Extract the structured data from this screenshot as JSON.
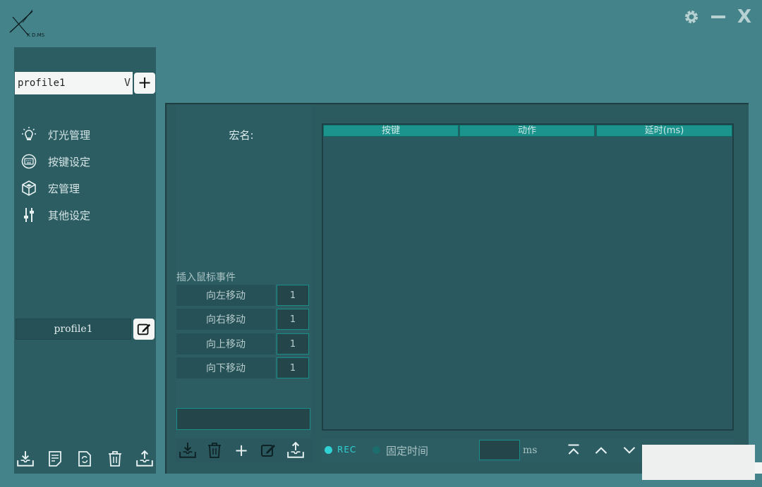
{
  "window": {
    "logo_text": "X D.MS",
    "controls": {
      "settings_icon": "gear-icon",
      "minimize_icon": "minimize-icon",
      "close_label": "X"
    }
  },
  "sidebar": {
    "profile_select": {
      "value": "profile1",
      "chevron": "V"
    },
    "add_profile_label": "+",
    "items": [
      {
        "label": "灯光管理",
        "icon": "lightbulb-icon"
      },
      {
        "label": "按键设定",
        "icon": "keyboard-icon"
      },
      {
        "label": "宏管理",
        "icon": "cube-icon"
      },
      {
        "label": "其他设定",
        "icon": "sliders-icon"
      }
    ],
    "profile_name": "profile1",
    "footer_icons": [
      "import-icon",
      "notes-icon",
      "refresh-file-icon",
      "trash-icon",
      "export-icon"
    ]
  },
  "macro": {
    "name_label": "宏名:",
    "insert_mouse_label": "插入鼠标事件",
    "moves": [
      {
        "label": "向左移动",
        "value": "1"
      },
      {
        "label": "向右移动",
        "value": "1"
      },
      {
        "label": "向上移动",
        "value": "1"
      },
      {
        "label": "向下移动",
        "value": "1"
      }
    ],
    "name_input_value": "",
    "toolbar": {
      "add_label": "+",
      "icons": [
        "import-icon",
        "trash-icon",
        "plus-icon",
        "edit-icon",
        "export-icon"
      ]
    }
  },
  "table": {
    "columns": [
      "按键",
      "动作",
      "延时(ms)"
    ],
    "rows": []
  },
  "bottom_bar": {
    "rec_label": "REC",
    "fixed_time_label": "固定时间",
    "ms_value": "",
    "ms_unit": "ms",
    "icons": [
      "move-top-icon",
      "chevron-up-icon",
      "chevron-down-icon"
    ]
  },
  "colors": {
    "background": "#44838a",
    "panel": "#2c5d63",
    "accent": "#1b948e",
    "rec": "#2fd3d5"
  }
}
